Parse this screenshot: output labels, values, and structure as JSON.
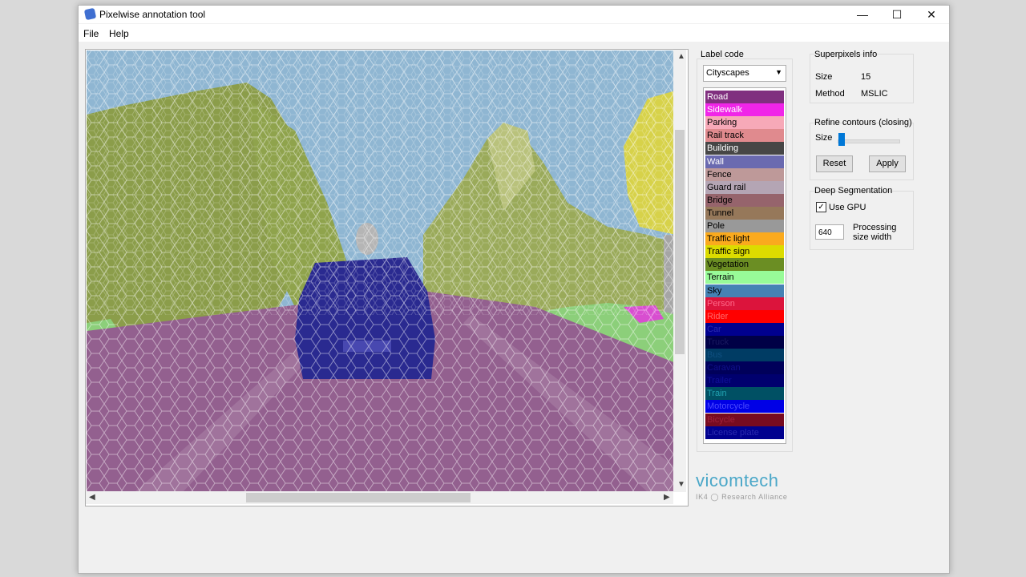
{
  "window": {
    "title": "Pixelwise annotation tool",
    "controls": {
      "minimize": "—",
      "maximize": "☐",
      "close": "✕"
    }
  },
  "menu": [
    "File",
    "Help"
  ],
  "label_code": {
    "title": "Label code",
    "dataset": "Cityscapes",
    "labels": [
      {
        "name": "Road",
        "color": "#80307f"
      },
      {
        "name": "Sidewalk",
        "color": "#f025e8"
      },
      {
        "name": "Parking",
        "color": "#f7a9b8"
      },
      {
        "name": "Rail track",
        "color": "#e08a8e"
      },
      {
        "name": "Building",
        "color": "#464646"
      },
      {
        "name": "Wall",
        "color": "#6a6ab0"
      },
      {
        "name": "Fence",
        "color": "#be9999"
      },
      {
        "name": "Guard rail",
        "color": "#b4a5b4"
      },
      {
        "name": "Bridge",
        "color": "#96646c"
      },
      {
        "name": "Tunnel",
        "color": "#96785a"
      },
      {
        "name": "Pole",
        "color": "#999999"
      },
      {
        "name": "Traffic light",
        "color": "#faaa1e"
      },
      {
        "name": "Traffic sign",
        "color": "#dcdc00"
      },
      {
        "name": "Vegetation",
        "color": "#6b8e23"
      },
      {
        "name": "Terrain",
        "color": "#98fb98"
      },
      {
        "name": "Sky",
        "color": "#4682b4"
      },
      {
        "name": "Person",
        "color": "#dc143c"
      },
      {
        "name": "Rider",
        "color": "#ff0000"
      },
      {
        "name": "Car",
        "color": "#00008e"
      },
      {
        "name": "Truck",
        "color": "#000046"
      },
      {
        "name": "Bus",
        "color": "#003c64"
      },
      {
        "name": "Caravan",
        "color": "#00005a"
      },
      {
        "name": "Trailer",
        "color": "#00006e"
      },
      {
        "name": "Train",
        "color": "#005064"
      },
      {
        "name": "Motorcycle",
        "color": "#0000e6"
      },
      {
        "name": "Bicycle",
        "color": "#770b20"
      },
      {
        "name": "License plate",
        "color": "#00008e"
      }
    ]
  },
  "superpixels": {
    "title": "Superpixels info",
    "size_label": "Size",
    "size_value": "15",
    "method_label": "Method",
    "method_value": "MSLIC"
  },
  "refine": {
    "title": "Refine contours (closing)",
    "size_label": "Size",
    "size_level": 0.05,
    "reset": "Reset",
    "apply": "Apply"
  },
  "deep": {
    "title": "Deep Segmentation",
    "use_gpu_label": "Use GPU",
    "use_gpu": true,
    "width_value": "640",
    "width_label_1": "Processing",
    "width_label_2": "size width"
  },
  "logo": {
    "name": "vicomtech",
    "sub": "IK4 ◯ Research Alliance"
  }
}
